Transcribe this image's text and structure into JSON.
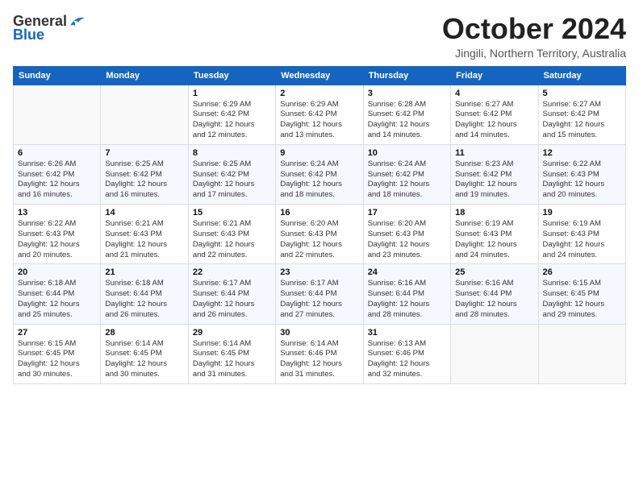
{
  "app": {
    "name": "GeneralBlue"
  },
  "title": "October 2024",
  "location": "Jingili, Northern Territory, Australia",
  "days_of_week": [
    "Sunday",
    "Monday",
    "Tuesday",
    "Wednesday",
    "Thursday",
    "Friday",
    "Saturday"
  ],
  "weeks": [
    [
      {
        "day": "",
        "info": ""
      },
      {
        "day": "",
        "info": ""
      },
      {
        "day": "1",
        "info": "Sunrise: 6:29 AM\nSunset: 6:42 PM\nDaylight: 12 hours\nand 12 minutes."
      },
      {
        "day": "2",
        "info": "Sunrise: 6:29 AM\nSunset: 6:42 PM\nDaylight: 12 hours\nand 13 minutes."
      },
      {
        "day": "3",
        "info": "Sunrise: 6:28 AM\nSunset: 6:42 PM\nDaylight: 12 hours\nand 14 minutes."
      },
      {
        "day": "4",
        "info": "Sunrise: 6:27 AM\nSunset: 6:42 PM\nDaylight: 12 hours\nand 14 minutes."
      },
      {
        "day": "5",
        "info": "Sunrise: 6:27 AM\nSunset: 6:42 PM\nDaylight: 12 hours\nand 15 minutes."
      }
    ],
    [
      {
        "day": "6",
        "info": "Sunrise: 6:26 AM\nSunset: 6:42 PM\nDaylight: 12 hours\nand 16 minutes."
      },
      {
        "day": "7",
        "info": "Sunrise: 6:25 AM\nSunset: 6:42 PM\nDaylight: 12 hours\nand 16 minutes."
      },
      {
        "day": "8",
        "info": "Sunrise: 6:25 AM\nSunset: 6:42 PM\nDaylight: 12 hours\nand 17 minutes."
      },
      {
        "day": "9",
        "info": "Sunrise: 6:24 AM\nSunset: 6:42 PM\nDaylight: 12 hours\nand 18 minutes."
      },
      {
        "day": "10",
        "info": "Sunrise: 6:24 AM\nSunset: 6:42 PM\nDaylight: 12 hours\nand 18 minutes."
      },
      {
        "day": "11",
        "info": "Sunrise: 6:23 AM\nSunset: 6:42 PM\nDaylight: 12 hours\nand 19 minutes."
      },
      {
        "day": "12",
        "info": "Sunrise: 6:22 AM\nSunset: 6:43 PM\nDaylight: 12 hours\nand 20 minutes."
      }
    ],
    [
      {
        "day": "13",
        "info": "Sunrise: 6:22 AM\nSunset: 6:43 PM\nDaylight: 12 hours\nand 20 minutes."
      },
      {
        "day": "14",
        "info": "Sunrise: 6:21 AM\nSunset: 6:43 PM\nDaylight: 12 hours\nand 21 minutes."
      },
      {
        "day": "15",
        "info": "Sunrise: 6:21 AM\nSunset: 6:43 PM\nDaylight: 12 hours\nand 22 minutes."
      },
      {
        "day": "16",
        "info": "Sunrise: 6:20 AM\nSunset: 6:43 PM\nDaylight: 12 hours\nand 22 minutes."
      },
      {
        "day": "17",
        "info": "Sunrise: 6:20 AM\nSunset: 6:43 PM\nDaylight: 12 hours\nand 23 minutes."
      },
      {
        "day": "18",
        "info": "Sunrise: 6:19 AM\nSunset: 6:43 PM\nDaylight: 12 hours\nand 24 minutes."
      },
      {
        "day": "19",
        "info": "Sunrise: 6:19 AM\nSunset: 6:43 PM\nDaylight: 12 hours\nand 24 minutes."
      }
    ],
    [
      {
        "day": "20",
        "info": "Sunrise: 6:18 AM\nSunset: 6:44 PM\nDaylight: 12 hours\nand 25 minutes."
      },
      {
        "day": "21",
        "info": "Sunrise: 6:18 AM\nSunset: 6:44 PM\nDaylight: 12 hours\nand 26 minutes."
      },
      {
        "day": "22",
        "info": "Sunrise: 6:17 AM\nSunset: 6:44 PM\nDaylight: 12 hours\nand 26 minutes."
      },
      {
        "day": "23",
        "info": "Sunrise: 6:17 AM\nSunset: 6:44 PM\nDaylight: 12 hours\nand 27 minutes."
      },
      {
        "day": "24",
        "info": "Sunrise: 6:16 AM\nSunset: 6:44 PM\nDaylight: 12 hours\nand 28 minutes."
      },
      {
        "day": "25",
        "info": "Sunrise: 6:16 AM\nSunset: 6:44 PM\nDaylight: 12 hours\nand 28 minutes."
      },
      {
        "day": "26",
        "info": "Sunrise: 6:15 AM\nSunset: 6:45 PM\nDaylight: 12 hours\nand 29 minutes."
      }
    ],
    [
      {
        "day": "27",
        "info": "Sunrise: 6:15 AM\nSunset: 6:45 PM\nDaylight: 12 hours\nand 30 minutes."
      },
      {
        "day": "28",
        "info": "Sunrise: 6:14 AM\nSunset: 6:45 PM\nDaylight: 12 hours\nand 30 minutes."
      },
      {
        "day": "29",
        "info": "Sunrise: 6:14 AM\nSunset: 6:45 PM\nDaylight: 12 hours\nand 31 minutes."
      },
      {
        "day": "30",
        "info": "Sunrise: 6:14 AM\nSunset: 6:46 PM\nDaylight: 12 hours\nand 31 minutes."
      },
      {
        "day": "31",
        "info": "Sunrise: 6:13 AM\nSunset: 6:46 PM\nDaylight: 12 hours\nand 32 minutes."
      },
      {
        "day": "",
        "info": ""
      },
      {
        "day": "",
        "info": ""
      }
    ]
  ]
}
